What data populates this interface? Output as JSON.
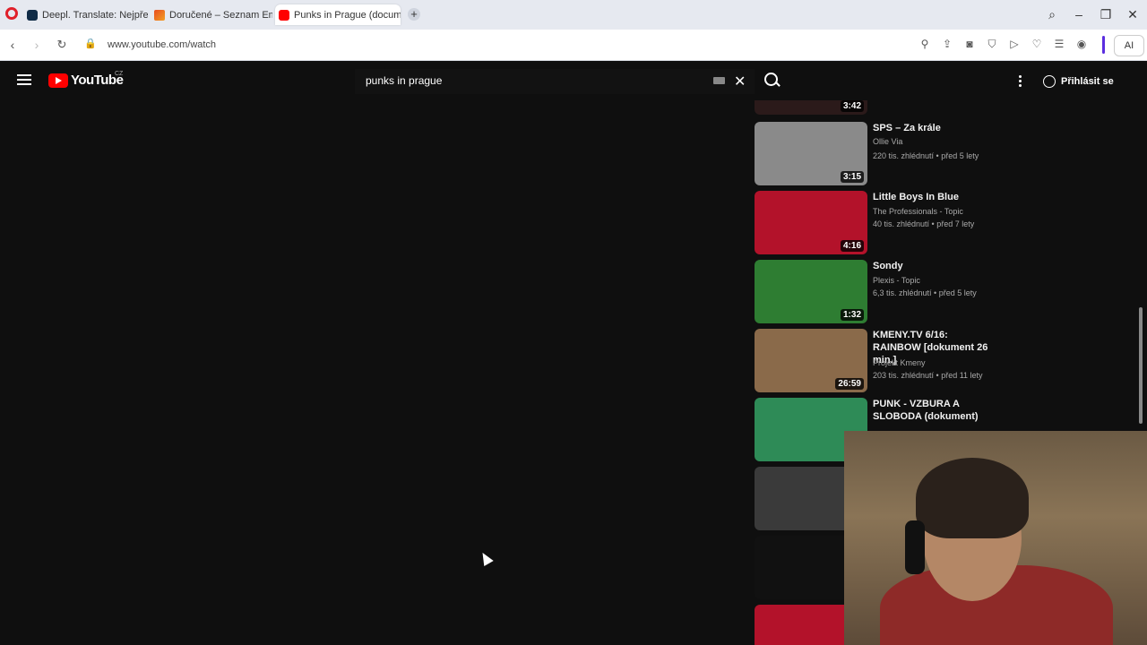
{
  "browser": {
    "tabs": [
      {
        "label": "Deepl. Translate: Nejpřesn",
        "active": false
      },
      {
        "label": "Doručené – Seznam Email",
        "active": false
      },
      {
        "label": "Punks in Prague (docume",
        "active": true
      }
    ],
    "new_tab": "+",
    "url": "www.youtube.com/watch",
    "ai_label": "AI"
  },
  "youtube": {
    "logo_text": "YouTube",
    "region": "CZ",
    "search_query": "punks in prague",
    "signin_label": "Přihlásit se",
    "related": [
      {
        "title": "",
        "channel": "",
        "meta": "",
        "duration": "3:42",
        "thumb_color": "#2b1a1a"
      },
      {
        "title": "SPS – Za krále",
        "channel": "Ollie Via",
        "meta": "220 tis. zhlédnutí • před 5 lety",
        "duration": "3:15",
        "thumb_color": "#8a8a8a"
      },
      {
        "title": "Little Boys In Blue",
        "channel": "The Professionals - Topic",
        "meta": "40 tis. zhlédnutí • před 7 lety",
        "duration": "4:16",
        "thumb_color": "#b3122a"
      },
      {
        "title": "Sondy",
        "channel": "Plexis - Topic",
        "meta": "6,3 tis. zhlédnutí • před 5 lety",
        "duration": "1:32",
        "thumb_color": "#2e7d32"
      },
      {
        "title": "KMENY.TV 6/16: RAINBOW [dokument 26 min.]",
        "channel": "Projekt Kmeny",
        "meta": "203 tis. zhlédnutí • před 11 lety",
        "duration": "26:59",
        "thumb_color": "#8a6a4a"
      },
      {
        "title": "PUNK - VZBURA A SLOBODA (dokument)",
        "channel": "",
        "meta": "",
        "duration": "",
        "thumb_color": "#2e8b57"
      },
      {
        "title": "",
        "channel": "",
        "meta": "",
        "duration": "",
        "thumb_color": "#3a3a3a"
      },
      {
        "title": "",
        "channel": "",
        "meta": "",
        "duration": "",
        "thumb_color": "#111111"
      },
      {
        "title": "",
        "channel": "",
        "meta": "",
        "duration": "",
        "thumb_color": "#b3122a"
      }
    ]
  }
}
